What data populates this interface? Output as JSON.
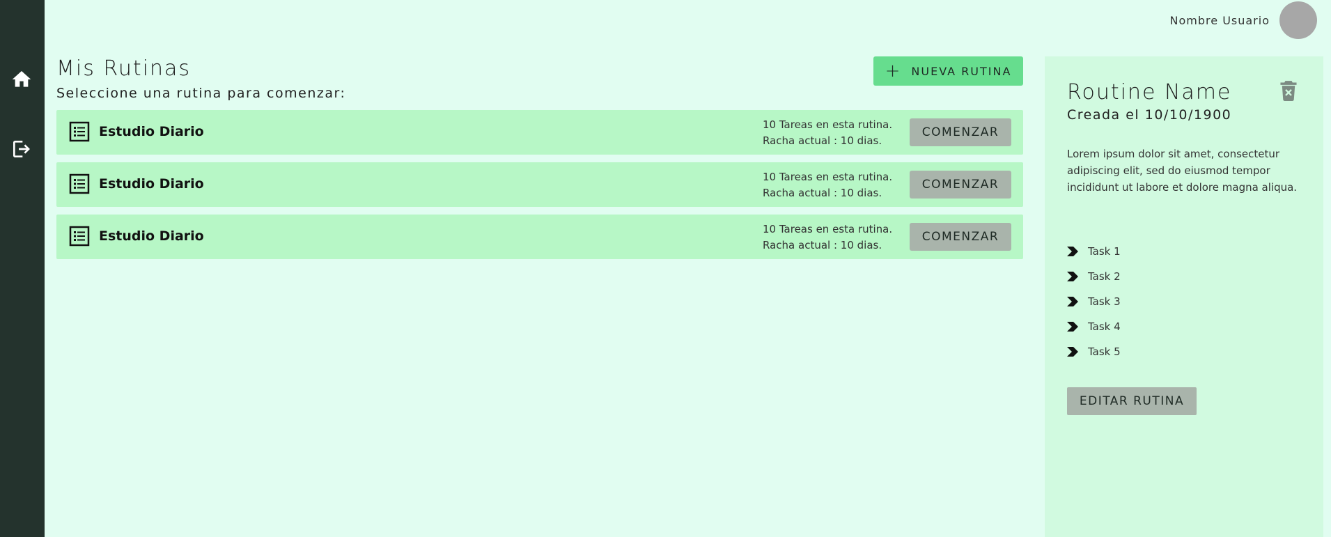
{
  "colors": {
    "sidebar": "#24332d",
    "background": "#e1fdf1",
    "row": "#b7f7c6",
    "panel": "#d1fae0",
    "accent": "#66dd8e",
    "button": "#a9b4ab"
  },
  "sidebar": {
    "items": [
      {
        "icon": "home-icon"
      },
      {
        "icon": "logout-icon"
      }
    ]
  },
  "header": {
    "username": "Nombre Usuario"
  },
  "main": {
    "title": "Mis Rutinas",
    "subtitle": "Seleccione una rutina para comenzar:",
    "new_button_label": "NUEVA RUTINA",
    "routines": [
      {
        "name": "Estudio Diario",
        "tasks_text": "10 Tareas en esta rutina.",
        "streak_text": "Racha actual : 10 dias.",
        "button_label": "COMENZAR"
      },
      {
        "name": "Estudio Diario",
        "tasks_text": "10 Tareas en esta rutina.",
        "streak_text": "Racha actual : 10 dias.",
        "button_label": "COMENZAR"
      },
      {
        "name": "Estudio Diario",
        "tasks_text": "10 Tareas en esta rutina.",
        "streak_text": "Racha actual : 10 dias.",
        "button_label": "COMENZAR"
      }
    ]
  },
  "detail": {
    "title": "Routine Name",
    "date": "Creada el 10/10/1900",
    "description": "Lorem ipsum dolor sit amet, consectetur adipiscing elit, sed do eiusmod tempor incididunt ut labore et dolore magna aliqua.",
    "tasks": [
      "Task 1",
      "Task 2",
      "Task 3",
      "Task 4",
      "Task 5"
    ],
    "edit_button_label": "EDITAR RUTINA"
  }
}
